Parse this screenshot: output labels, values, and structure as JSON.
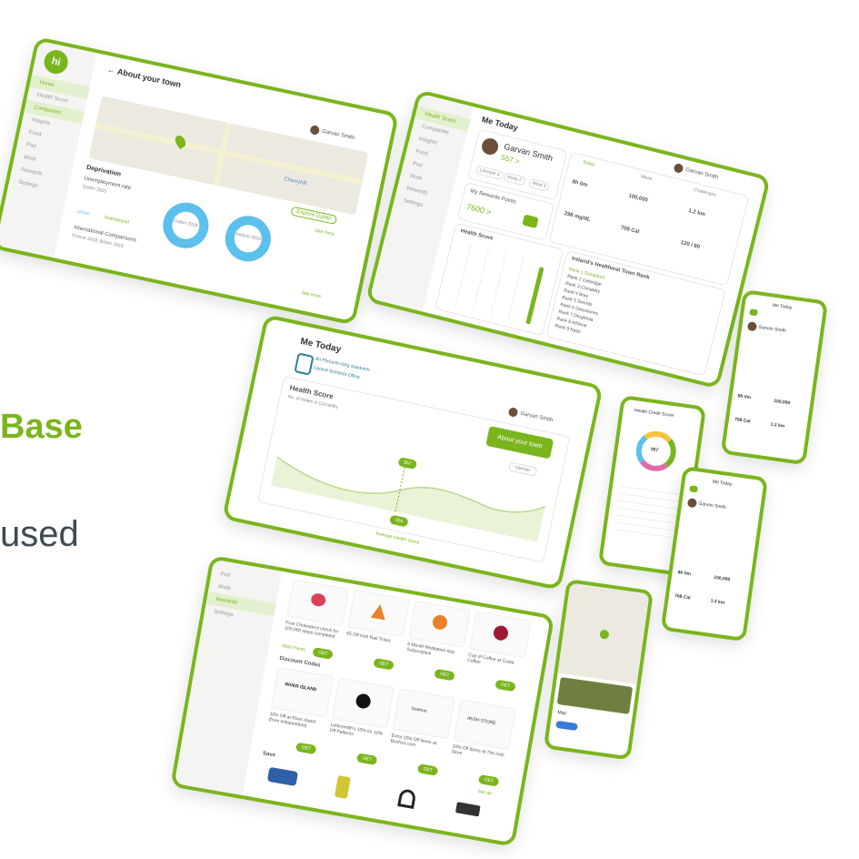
{
  "slide": {
    "title_fragment": "Base",
    "subtitle_fragment": "used"
  },
  "colors": {
    "brand": "#7ab51d",
    "ring": "#5bc0eb",
    "text": "#3d4a55"
  },
  "tablet1": {
    "logo": "hi",
    "back_title": "← About your town",
    "user_name": "Garvan Smith",
    "section": "Deprivation",
    "metric": "Unemployment rate",
    "metric_sub": "Dublin 2015",
    "btn_explore": "Explore Dublin",
    "btn_see_more": "See more",
    "legend_a": "Urban",
    "legend_b": "Unemployed",
    "compare_title": "International Comparisons",
    "compare_sub": "France 2018, Britain 2018",
    "donut1_label": "Dublin 2018",
    "donut2_label": "Ireland 2018",
    "map_chip": "Cherryhill",
    "footer_link": "See more",
    "nav": [
      "Home",
      "Health Score",
      "Companies",
      "Insights",
      "Food",
      "Pod",
      "Work",
      "Rewards",
      "Settings"
    ]
  },
  "tablet2": {
    "title": "Me Today",
    "user_name": "Garvan Smith",
    "user_score": "557 >",
    "chips": [
      "Lifestyle 3",
      "Body 2",
      "Mind 3"
    ],
    "points_label": "My Rewards Points",
    "points_value": "7600 >",
    "tabs": [
      "Today",
      "Week",
      "Challenges"
    ],
    "stats": [
      "8h 0m",
      "100,000",
      "1.2 km",
      "298 mg/dL",
      "708 Cal",
      "120 / 80"
    ],
    "health_score_label": "Health Score",
    "rank_title": "Ireland's Healthiest Town Rank",
    "ranks": [
      "Rank 1 Sandyford",
      "Rank 2 Celbridge",
      "Rank 3 Clonakilty",
      "Rank 4 Bray",
      "Rank 5 Swords",
      "Rank 6 Greystones",
      "Rank 7 Drogheda",
      "Rank 8 Athlone",
      "Rank 9 Naas"
    ],
    "nav": [
      "Health Score",
      "Companies",
      "Insights",
      "Food",
      "Pod",
      "Work",
      "Rewards",
      "Settings"
    ]
  },
  "tablet3": {
    "title": "Me Today",
    "logo_text": "An Phríomh-Oifig Staidrimh",
    "logo_text2": "Central Statistics Office",
    "user_name": "Garvan Smith",
    "card_title": "Health Score",
    "card_sub": "No. of Males in Clonakilty",
    "cta": "About your town",
    "dropdown": "Gender",
    "marker": "557",
    "footer_value": "556",
    "footer_caption": "Average Health Score"
  },
  "tablet4": {
    "section_offers": "Discount Codes",
    "section_save": "Save",
    "see_all": "See all",
    "offers": [
      "Free Cholesterol check for 100,000 steps completed",
      "€5 Off Irish Rail Ticket",
      "6 Month Meditation App Subscription",
      "Cup of Coffee at Costa Coffee"
    ],
    "codes": [
      "10% Off at River Island (from Independent)",
      "Lettersmith's 10% for 10% Off Patterns",
      "Extra 15% Off Items at Boohoo.com",
      "10% Off Items at The Irish Store"
    ],
    "brands": [
      "RIVER ISLAND",
      "boohoo",
      "IRISH STORE"
    ],
    "points": "3000 Points",
    "btn_get": "GET",
    "nav": [
      "Pod",
      "Work",
      "Rewards",
      "Settings"
    ]
  },
  "phone1": {
    "title": "Me Today",
    "user_name": "Garvan Smith",
    "stats": [
      "8h 0m",
      "100,000",
      "708 Cal",
      "1.2 km"
    ]
  },
  "phone2": {
    "title": "Health Credit Score",
    "score": "557"
  },
  "phone3": {
    "title": "Me Today",
    "user_name": "Garvan Smith",
    "stats": [
      "8h 0m",
      "100,000",
      "708 Cal",
      "1.2 km"
    ]
  },
  "phone4": {
    "title": "Map"
  }
}
